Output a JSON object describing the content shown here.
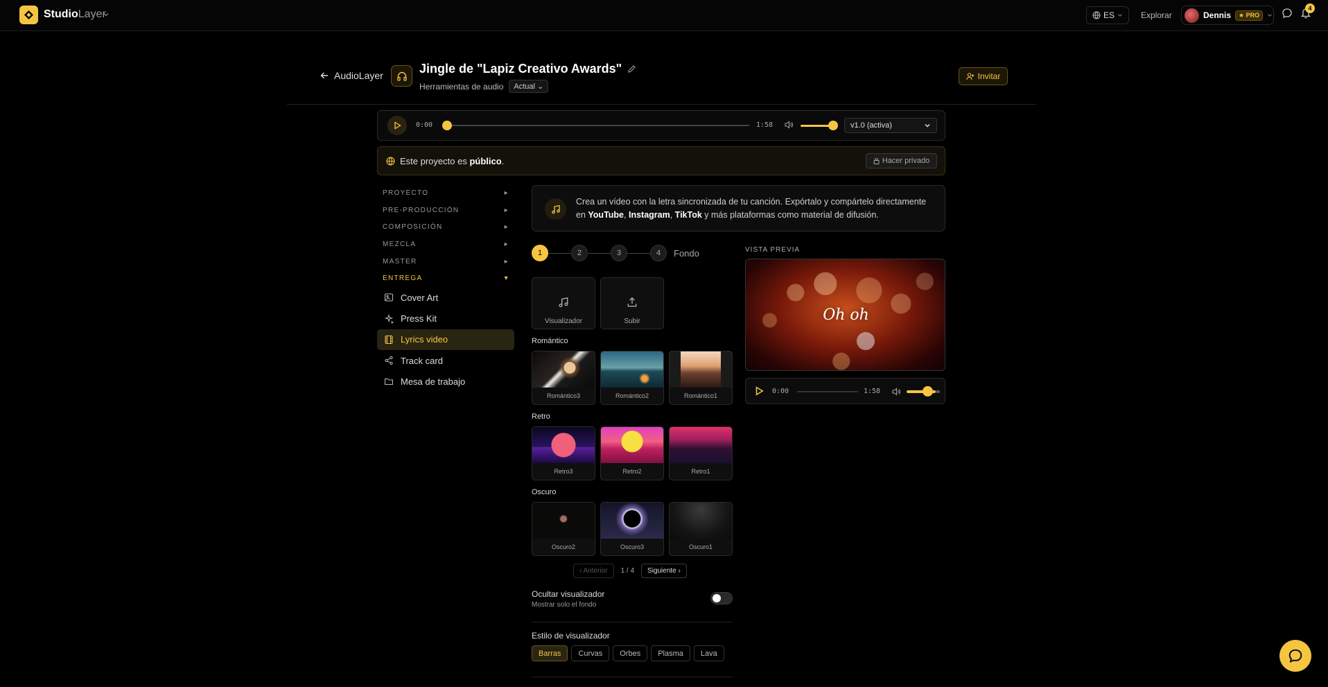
{
  "nav": {
    "brand_bold": "Studio",
    "brand_light": "Layer",
    "lang": "ES",
    "explore": "Explorar",
    "user": "Dennis",
    "badge": "★ PRO",
    "notifications": "4"
  },
  "header": {
    "back_label": "AudioLayer",
    "title": "Jingle de \"Lapiz Creativo Awards\"",
    "subtitle": "Herramientas de audio",
    "version_badge": "Actual",
    "invite": "Invitar"
  },
  "player": {
    "time_current": "0:00",
    "time_total": "1:58",
    "progress": 0,
    "volume": 0.85,
    "version": "v1.0 (activa)"
  },
  "banner": {
    "text_prefix": "Este proyecto es ",
    "text_bold": "público",
    "text_suffix": ".",
    "private_button": "Hacer privado"
  },
  "sidebar": {
    "sections": [
      {
        "label": "PROYECTO"
      },
      {
        "label": "PRE-PRODUCCIÓN"
      },
      {
        "label": "COMPOSICIÓN"
      },
      {
        "label": "MEZCLA"
      },
      {
        "label": "MASTER"
      },
      {
        "label": "ENTREGA"
      }
    ],
    "items": [
      {
        "label": "Cover Art",
        "icon": "image-edit-icon"
      },
      {
        "label": "Press Kit",
        "icon": "sparkles-icon"
      },
      {
        "label": "Lyrics video",
        "icon": "film-icon"
      },
      {
        "label": "Track card",
        "icon": "share-icon"
      },
      {
        "label": "Mesa de trabajo",
        "icon": "folder-icon"
      }
    ]
  },
  "intro": {
    "text_1": "Crea un vídeo con la letra sincronizada de tu canción. Expórtalo y compártelo directamente en ",
    "bold_1": "YouTube",
    "sep_1": ", ",
    "bold_2": "Instagram",
    "sep_2": ", ",
    "bold_3": "TikTok",
    "text_2": " y más plataformas como material de difusión."
  },
  "stepper": {
    "steps": [
      "1",
      "2",
      "3",
      "4"
    ],
    "label": "Fondo"
  },
  "backgrounds": {
    "uploads": [
      {
        "label": "Visualizador",
        "icon": "music-note-icon"
      },
      {
        "label": "Subir",
        "icon": "upload-icon"
      }
    ],
    "categories": [
      {
        "name": "Romántico",
        "tiles": [
          "Romántico3",
          "Romántico2",
          "Romántico1"
        ]
      },
      {
        "name": "Retro",
        "tiles": [
          "Retro3",
          "Retro2",
          "Retro1"
        ]
      },
      {
        "name": "Oscuro",
        "tiles": [
          "Oscuro2",
          "Oscuro3",
          "Oscuro1"
        ]
      }
    ]
  },
  "pagination": {
    "prev": "‹ Anterior",
    "page": "1 / 4",
    "next": "Siguiente ›"
  },
  "options": {
    "hide_title": "Ocultar visualizador",
    "hide_sub": "Mostrar solo el fondo",
    "style_title": "Estilo de visualizador",
    "styles": [
      "Barras",
      "Curvas",
      "Orbes",
      "Plasma",
      "Lava"
    ]
  },
  "preview": {
    "label": "VISTA PREVIA",
    "lyric": "Oh oh",
    "time_current": "0:00",
    "time_total": "1:58"
  },
  "colors": {
    "accent": "#f5c542",
    "background": "#000000"
  }
}
